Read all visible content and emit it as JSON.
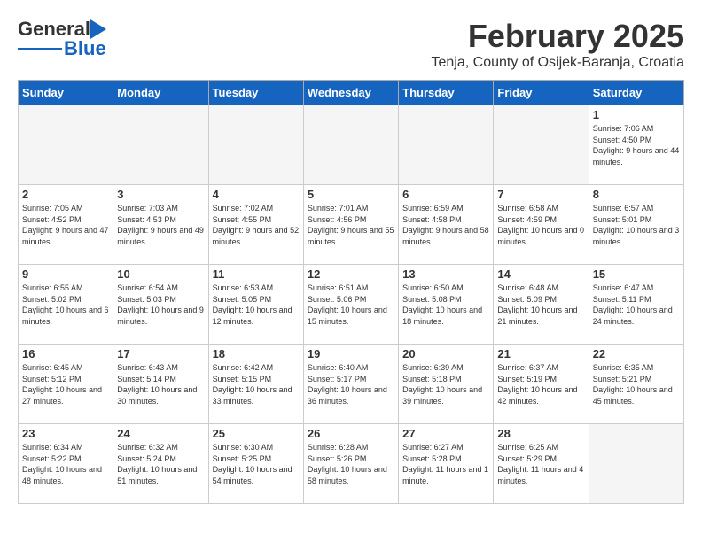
{
  "header": {
    "logo_general": "General",
    "logo_blue": "Blue",
    "month": "February 2025",
    "location": "Tenja, County of Osijek-Baranja, Croatia"
  },
  "days_of_week": [
    "Sunday",
    "Monday",
    "Tuesday",
    "Wednesday",
    "Thursday",
    "Friday",
    "Saturday"
  ],
  "weeks": [
    [
      {
        "day": "",
        "info": ""
      },
      {
        "day": "",
        "info": ""
      },
      {
        "day": "",
        "info": ""
      },
      {
        "day": "",
        "info": ""
      },
      {
        "day": "",
        "info": ""
      },
      {
        "day": "",
        "info": ""
      },
      {
        "day": "1",
        "info": "Sunrise: 7:06 AM\nSunset: 4:50 PM\nDaylight: 9 hours and 44 minutes."
      }
    ],
    [
      {
        "day": "2",
        "info": "Sunrise: 7:05 AM\nSunset: 4:52 PM\nDaylight: 9 hours and 47 minutes."
      },
      {
        "day": "3",
        "info": "Sunrise: 7:03 AM\nSunset: 4:53 PM\nDaylight: 9 hours and 49 minutes."
      },
      {
        "day": "4",
        "info": "Sunrise: 7:02 AM\nSunset: 4:55 PM\nDaylight: 9 hours and 52 minutes."
      },
      {
        "day": "5",
        "info": "Sunrise: 7:01 AM\nSunset: 4:56 PM\nDaylight: 9 hours and 55 minutes."
      },
      {
        "day": "6",
        "info": "Sunrise: 6:59 AM\nSunset: 4:58 PM\nDaylight: 9 hours and 58 minutes."
      },
      {
        "day": "7",
        "info": "Sunrise: 6:58 AM\nSunset: 4:59 PM\nDaylight: 10 hours and 0 minutes."
      },
      {
        "day": "8",
        "info": "Sunrise: 6:57 AM\nSunset: 5:01 PM\nDaylight: 10 hours and 3 minutes."
      }
    ],
    [
      {
        "day": "9",
        "info": "Sunrise: 6:55 AM\nSunset: 5:02 PM\nDaylight: 10 hours and 6 minutes."
      },
      {
        "day": "10",
        "info": "Sunrise: 6:54 AM\nSunset: 5:03 PM\nDaylight: 10 hours and 9 minutes."
      },
      {
        "day": "11",
        "info": "Sunrise: 6:53 AM\nSunset: 5:05 PM\nDaylight: 10 hours and 12 minutes."
      },
      {
        "day": "12",
        "info": "Sunrise: 6:51 AM\nSunset: 5:06 PM\nDaylight: 10 hours and 15 minutes."
      },
      {
        "day": "13",
        "info": "Sunrise: 6:50 AM\nSunset: 5:08 PM\nDaylight: 10 hours and 18 minutes."
      },
      {
        "day": "14",
        "info": "Sunrise: 6:48 AM\nSunset: 5:09 PM\nDaylight: 10 hours and 21 minutes."
      },
      {
        "day": "15",
        "info": "Sunrise: 6:47 AM\nSunset: 5:11 PM\nDaylight: 10 hours and 24 minutes."
      }
    ],
    [
      {
        "day": "16",
        "info": "Sunrise: 6:45 AM\nSunset: 5:12 PM\nDaylight: 10 hours and 27 minutes."
      },
      {
        "day": "17",
        "info": "Sunrise: 6:43 AM\nSunset: 5:14 PM\nDaylight: 10 hours and 30 minutes."
      },
      {
        "day": "18",
        "info": "Sunrise: 6:42 AM\nSunset: 5:15 PM\nDaylight: 10 hours and 33 minutes."
      },
      {
        "day": "19",
        "info": "Sunrise: 6:40 AM\nSunset: 5:17 PM\nDaylight: 10 hours and 36 minutes."
      },
      {
        "day": "20",
        "info": "Sunrise: 6:39 AM\nSunset: 5:18 PM\nDaylight: 10 hours and 39 minutes."
      },
      {
        "day": "21",
        "info": "Sunrise: 6:37 AM\nSunset: 5:19 PM\nDaylight: 10 hours and 42 minutes."
      },
      {
        "day": "22",
        "info": "Sunrise: 6:35 AM\nSunset: 5:21 PM\nDaylight: 10 hours and 45 minutes."
      }
    ],
    [
      {
        "day": "23",
        "info": "Sunrise: 6:34 AM\nSunset: 5:22 PM\nDaylight: 10 hours and 48 minutes."
      },
      {
        "day": "24",
        "info": "Sunrise: 6:32 AM\nSunset: 5:24 PM\nDaylight: 10 hours and 51 minutes."
      },
      {
        "day": "25",
        "info": "Sunrise: 6:30 AM\nSunset: 5:25 PM\nDaylight: 10 hours and 54 minutes."
      },
      {
        "day": "26",
        "info": "Sunrise: 6:28 AM\nSunset: 5:26 PM\nDaylight: 10 hours and 58 minutes."
      },
      {
        "day": "27",
        "info": "Sunrise: 6:27 AM\nSunset: 5:28 PM\nDaylight: 11 hours and 1 minute."
      },
      {
        "day": "28",
        "info": "Sunrise: 6:25 AM\nSunset: 5:29 PM\nDaylight: 11 hours and 4 minutes."
      },
      {
        "day": "",
        "info": ""
      }
    ]
  ]
}
